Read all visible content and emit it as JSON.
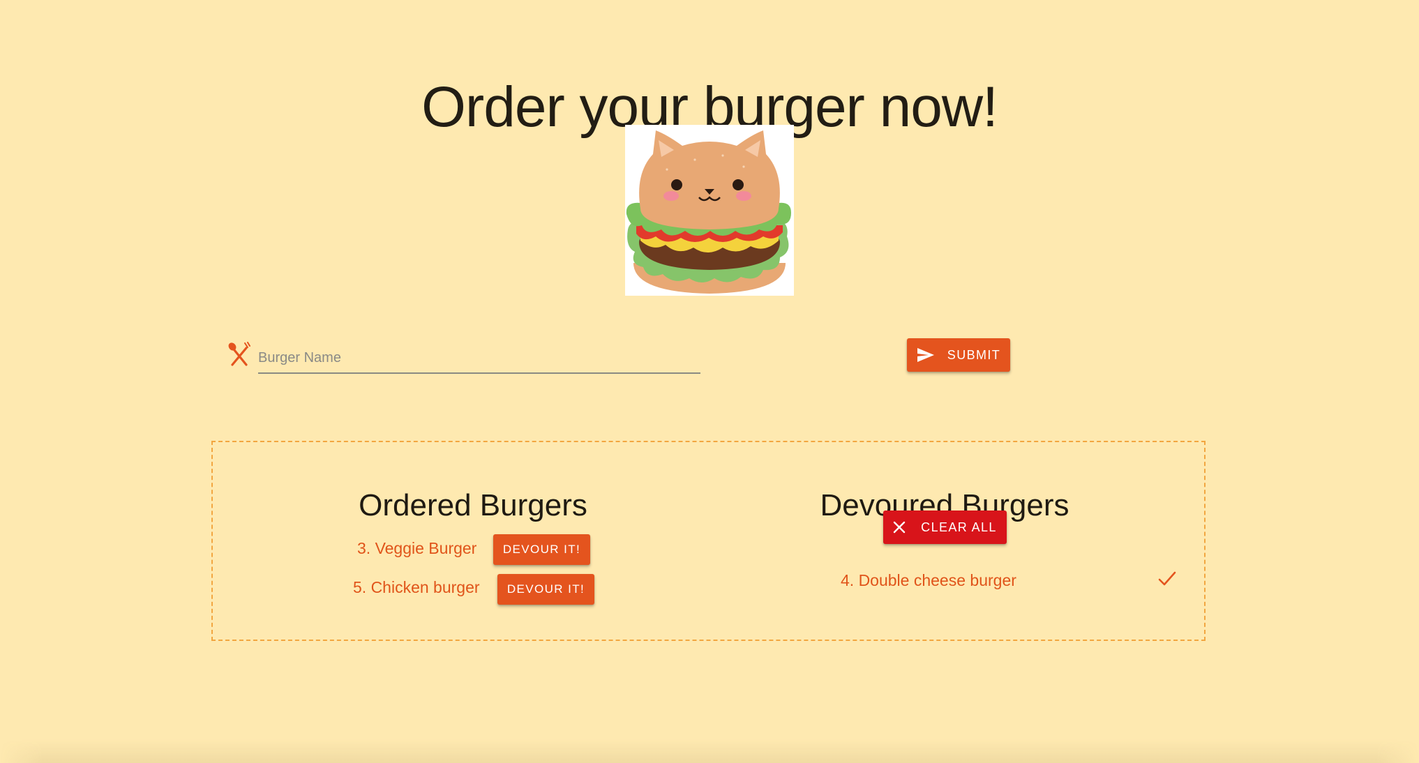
{
  "page": {
    "title": "Order your burger now!",
    "background_color": "#fee9b0",
    "accent_color": "#e4541e",
    "danger_color": "#d8141a"
  },
  "hero": {
    "image_icon": "cat-burger-illustration"
  },
  "form": {
    "icon": "fork-spoon-icon",
    "placeholder": "Burger Name",
    "value": "",
    "submit_label": "Submit",
    "submit_icon": "send-icon"
  },
  "ordered": {
    "heading": "Ordered Burgers",
    "items": [
      {
        "label": "3. Veggie Burger",
        "button_label": "Devour it!"
      },
      {
        "label": "5. Chicken burger",
        "button_label": "Devour it!"
      }
    ]
  },
  "devoured": {
    "heading": "Devoured Burgers",
    "clear_label": "Clear all",
    "clear_icon": "close-icon",
    "items": [
      {
        "label": "4. Double cheese burger",
        "status_icon": "check-icon"
      }
    ]
  }
}
